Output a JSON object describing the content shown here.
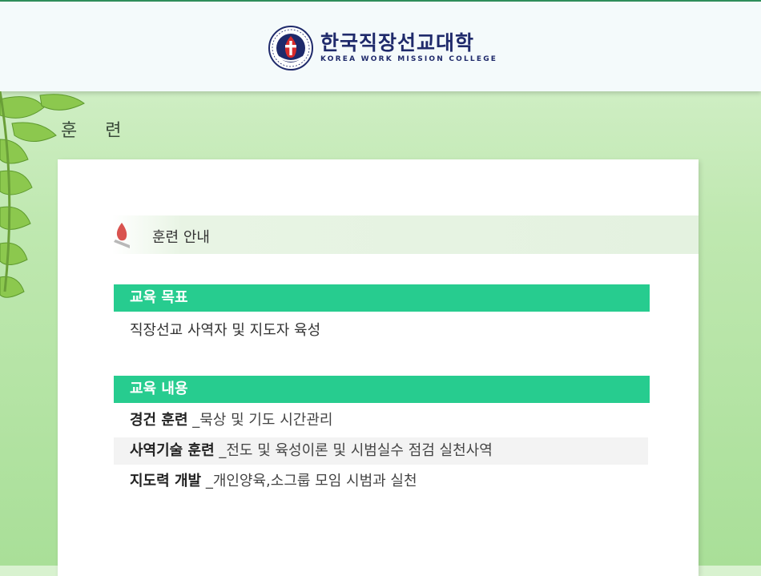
{
  "header": {
    "logo_ko": "한국직장선교대학",
    "logo_en": "KOREA WORK MISSION COLLEGE"
  },
  "page": {
    "heading": "훈 련"
  },
  "section": {
    "title": "훈련 안내"
  },
  "goal": {
    "label": "교육 목표",
    "text": "직장선교 사역자 및 지도자 육성"
  },
  "content": {
    "label": "교육 내용",
    "items": [
      {
        "name": "경건 훈련",
        "detail": "_묵상 및 기도 시간관리"
      },
      {
        "name": "사역기술 훈련",
        "detail": "_전도 및 육성이론 및 시범실수 점검 실천사역"
      },
      {
        "name": "지도력 개발",
        "detail": "_개인양육,소그룹 모임 시범과 실천"
      }
    ]
  },
  "colors": {
    "accent_green": "#27cc8f",
    "logo_navy": "#1f2a6b"
  }
}
